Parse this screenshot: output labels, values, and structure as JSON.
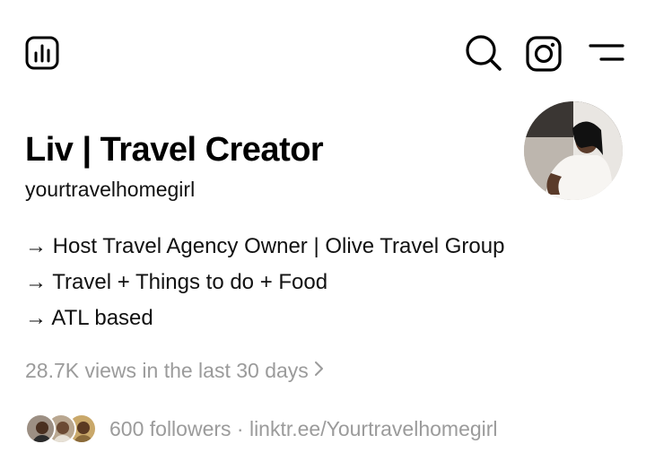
{
  "header": {
    "insights_icon": "bar-chart-icon",
    "search_icon": "search-icon",
    "instagram_icon": "instagram-icon",
    "menu_icon": "menu-icon"
  },
  "profile": {
    "name": "Liv | Travel Creator",
    "username": "yourtravelhomegirl",
    "bio": [
      "→ Host Travel Agency Owner | Olive Travel Group",
      "→ Travel + Things to do + Food",
      "→ ATL based"
    ],
    "views": "28.7K views in the last 30 days",
    "followers_line": "600 followers · linktr.ee/Yourtravelhomegirl"
  },
  "colors": {
    "text_primary": "#000000",
    "text_secondary": "#9b9b9b",
    "background": "#ffffff"
  }
}
